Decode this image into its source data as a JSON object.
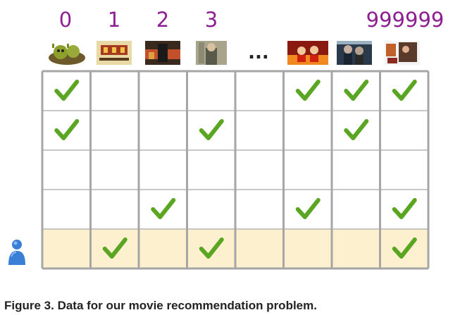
{
  "movie_indices": [
    "0",
    "1",
    "2",
    "3",
    "999999"
  ],
  "ellipsis": "...",
  "movie_thumbnails": [
    "shrek-poster",
    "triplets-of-belleville-poster",
    "dark-knight-poster",
    "harry-potter-poster",
    "incredibles-poster",
    "movie-poster-6",
    "movie-poster-7"
  ],
  "colors": {
    "index_text": "#8e1f93",
    "grid_line": "#a6a6a6",
    "check": "#5aa522",
    "highlight_row": "#fdf0cf",
    "avatar": "#3a7fd6"
  },
  "matrix": {
    "rows": 5,
    "columns": 8,
    "checks": [
      [
        1,
        0,
        0,
        0,
        0,
        1,
        1,
        1
      ],
      [
        1,
        0,
        0,
        1,
        0,
        0,
        1,
        0
      ],
      [
        0,
        0,
        0,
        0,
        0,
        0,
        0,
        0
      ],
      [
        0,
        0,
        1,
        0,
        0,
        1,
        0,
        1
      ],
      [
        0,
        1,
        0,
        1,
        0,
        0,
        0,
        1
      ]
    ],
    "highlighted_row": 4
  },
  "user_icon": "user-icon",
  "caption": "Figure 3. Data for our movie recommendation problem."
}
